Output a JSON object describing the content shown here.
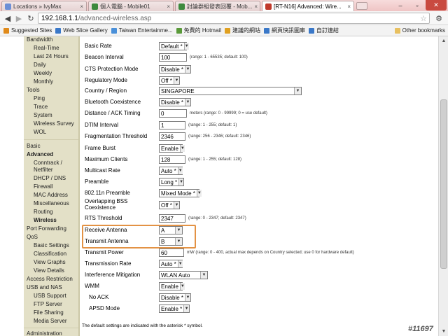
{
  "browser": {
    "tabs": [
      {
        "label": "Locations » IvyMax",
        "color": "#6c8fd6"
      },
      {
        "label": "個人電腦 - Mobile01",
        "color": "#3d8a3d"
      },
      {
        "label": "討論群組發表回覆 - Mob...",
        "color": "#3d8a3d"
      },
      {
        "label": "[RT-N16] Advanced: Wire...",
        "color": "#c0392b"
      }
    ],
    "url_host": "192.168.1.1",
    "url_path": "/advanced-wireless.asp",
    "bookmarks": [
      {
        "label": "Suggested Sites",
        "color": "#e08a1a"
      },
      {
        "label": "Web Slice Gallery",
        "color": "#3a78c8"
      },
      {
        "label": "Taiwan Entertainme...",
        "color": "#4a90d9"
      },
      {
        "label": "免費的 Hotmail",
        "color": "#5a9a3a"
      },
      {
        "label": "建議的網站",
        "color": "#e0a020"
      },
      {
        "label": "網頁快訊圖庫",
        "color": "#3a78c8"
      },
      {
        "label": "自訂連結",
        "color": "#3a78c8"
      }
    ],
    "other_bookmarks": "Other bookmarks"
  },
  "nav": {
    "items": [
      {
        "label": "Bandwidth",
        "level": 0,
        "bold": false
      },
      {
        "label": "Real-Time",
        "level": 1,
        "bold": false
      },
      {
        "label": "Last 24 Hours",
        "level": 1,
        "bold": false
      },
      {
        "label": "Daily",
        "level": 1,
        "bold": false
      },
      {
        "label": "Weekly",
        "level": 1,
        "bold": false
      },
      {
        "label": "Monthly",
        "level": 1,
        "bold": false
      },
      {
        "label": "Tools",
        "level": 0,
        "bold": false
      },
      {
        "label": "Ping",
        "level": 1,
        "bold": false
      },
      {
        "label": "Trace",
        "level": 1,
        "bold": false
      },
      {
        "label": "System",
        "level": 1,
        "bold": false
      },
      {
        "label": "Wireless Survey",
        "level": 1,
        "bold": false
      },
      {
        "label": "WOL",
        "level": 1,
        "bold": false
      },
      {
        "label": "Basic",
        "level": 0,
        "bold": false
      },
      {
        "label": "Advanced",
        "level": 0,
        "bold": true
      },
      {
        "label": "Conntrack /",
        "level": 1,
        "bold": false
      },
      {
        "label": "Netfilter",
        "level": 1,
        "bold": false
      },
      {
        "label": "DHCP / DNS",
        "level": 1,
        "bold": false
      },
      {
        "label": "Firewall",
        "level": 1,
        "bold": false
      },
      {
        "label": "MAC Address",
        "level": 1,
        "bold": false
      },
      {
        "label": "Miscellaneous",
        "level": 1,
        "bold": false
      },
      {
        "label": "Routing",
        "level": 1,
        "bold": false
      },
      {
        "label": "Wireless",
        "level": 1,
        "bold": true
      },
      {
        "label": "Port Forwarding",
        "level": 0,
        "bold": false
      },
      {
        "label": "QoS",
        "level": 0,
        "bold": false
      },
      {
        "label": "Basic Settings",
        "level": 1,
        "bold": false
      },
      {
        "label": "Classification",
        "level": 1,
        "bold": false
      },
      {
        "label": "View Graphs",
        "level": 1,
        "bold": false
      },
      {
        "label": "View Details",
        "level": 1,
        "bold": false
      },
      {
        "label": "Access Restriction",
        "level": 0,
        "bold": false
      },
      {
        "label": "USB and NAS",
        "level": 0,
        "bold": false
      },
      {
        "label": "USB Support",
        "level": 1,
        "bold": false
      },
      {
        "label": "FTP Server",
        "level": 1,
        "bold": false
      },
      {
        "label": "File Sharing",
        "level": 1,
        "bold": false
      },
      {
        "label": "Media Server",
        "level": 1,
        "bold": false
      },
      {
        "label": "Administration",
        "level": 0,
        "bold": false
      }
    ]
  },
  "form": {
    "rows": [
      {
        "label": "Basic Rate",
        "type": "select",
        "value": "Default *",
        "hint": ""
      },
      {
        "label": "Beacon Interval",
        "type": "text",
        "value": "100",
        "hint": "(range: 1 - 65535; default: 100)"
      },
      {
        "label": "CTS Protection Mode",
        "type": "select",
        "value": "Disable *",
        "hint": ""
      },
      {
        "label": "Regulatory Mode",
        "type": "select",
        "value": "Off *",
        "hint": ""
      },
      {
        "label": "Country / Region",
        "type": "select",
        "value": "SINGAPORE",
        "hint": ""
      },
      {
        "label": "Bluetooth Coexistence",
        "type": "select",
        "value": "Disable *",
        "hint": ""
      },
      {
        "label": "Distance / ACK Timing",
        "type": "text",
        "value": "0",
        "hint": "meters  (range: 0 - 99999; 0 = use default)"
      },
      {
        "label": "DTIM Interval",
        "type": "text",
        "value": "1",
        "hint": "(range: 1 - 255; default: 1)"
      },
      {
        "label": "Fragmentation Threshold",
        "type": "text",
        "value": "2346",
        "hint": "(range: 256 - 2346; default: 2346)"
      },
      {
        "label": "Frame Burst",
        "type": "select",
        "value": "Enable",
        "hint": ""
      },
      {
        "label": "Maximum Clients",
        "type": "text",
        "value": "128",
        "hint": "(range: 1 - 255; default: 128)"
      },
      {
        "label": "Multicast Rate",
        "type": "select",
        "value": "Auto *",
        "hint": ""
      },
      {
        "label": "Preamble",
        "type": "select",
        "value": "Long *",
        "hint": ""
      },
      {
        "label": "802.11n Preamble",
        "type": "select",
        "value": "Mixed Mode *",
        "hint": ""
      },
      {
        "label": "Overlapping BSS Coexistence",
        "type": "select",
        "value": "Off *",
        "hint": ""
      },
      {
        "label": "RTS Threshold",
        "type": "text",
        "value": "2347",
        "hint": "(range: 0 - 2347; default: 2347)"
      },
      {
        "label": "Receive Antenna",
        "type": "select",
        "value": "A",
        "hint": ""
      },
      {
        "label": "Transmit Antenna",
        "type": "select",
        "value": "B",
        "hint": ""
      },
      {
        "label": "Transmit Power",
        "type": "text",
        "value": "60",
        "hint": "mW  (range: 0 - 400, actual max depends on Country selected; use 0 for hardware default)"
      },
      {
        "label": "Transmission Rate",
        "type": "select",
        "value": "Auto *",
        "hint": ""
      },
      {
        "label": "Interference Mitigation",
        "type": "select",
        "value": "WLAN Auto",
        "hint": ""
      },
      {
        "label": "WMM",
        "type": "select",
        "value": "Enable",
        "hint": ""
      },
      {
        "label": "No ACK",
        "type": "select",
        "value": "Disable *",
        "hint": ""
      },
      {
        "label": "APSD Mode",
        "type": "select",
        "value": "Enable *",
        "hint": ""
      }
    ],
    "footnote": "The default settings are indicated with the asterisk * symbol."
  },
  "watermark": "#11697",
  "colors": {
    "highlight": "#e39244",
    "nav_bg": "#e3e0c7"
  }
}
